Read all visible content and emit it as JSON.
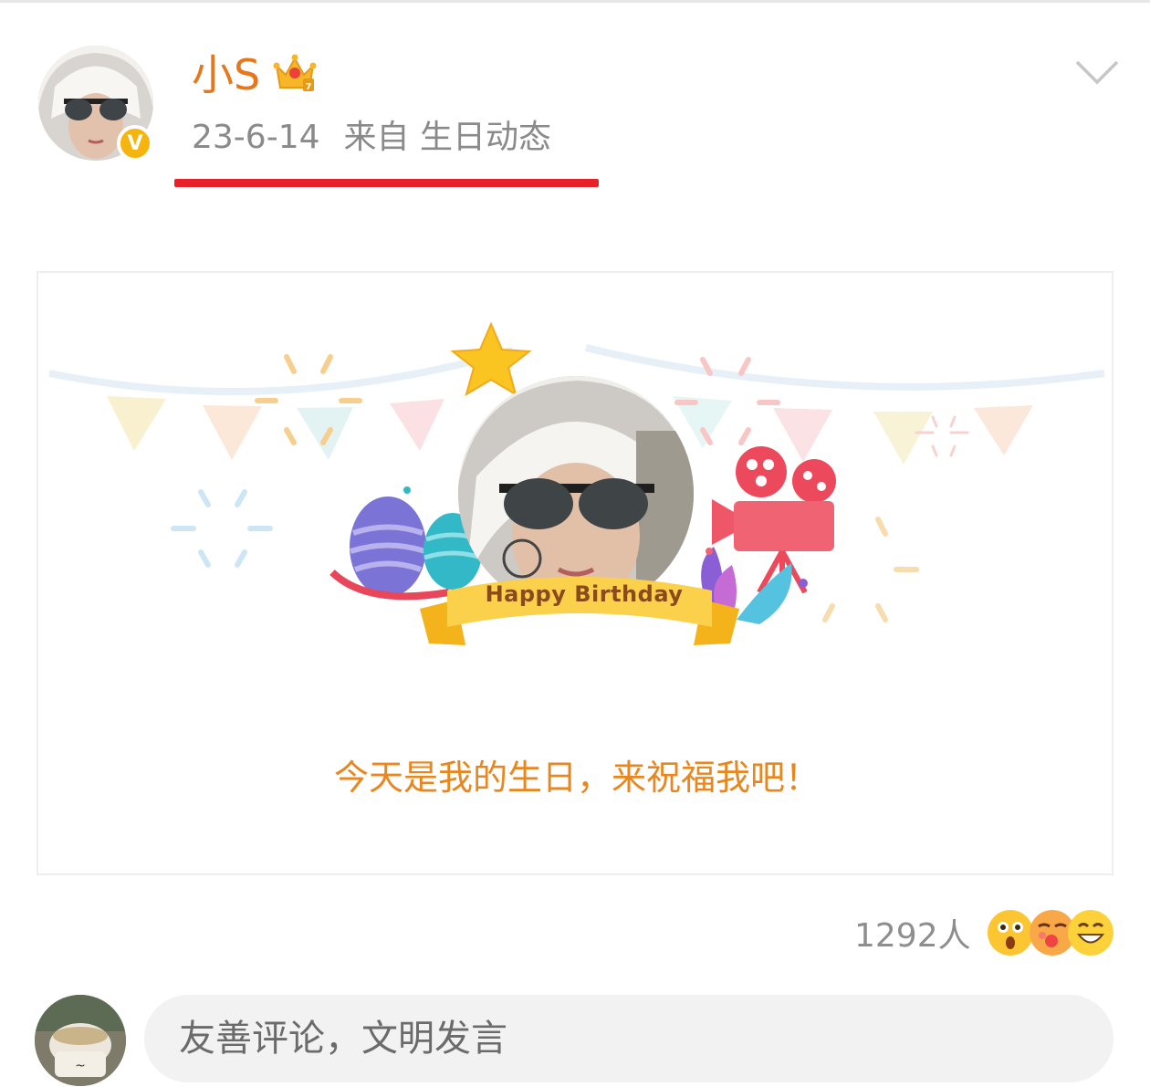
{
  "post": {
    "username": "小S",
    "date": "23-6-14",
    "source": "来自 生日动态"
  },
  "card": {
    "banner_text": "Happy Birthday",
    "blessing": "今天是我的生日，来祝福我吧！"
  },
  "reactions": {
    "count_label": "1292人",
    "emojis": [
      "surprised-emoji-icon",
      "kiss-emoji-icon",
      "grin-emoji-icon"
    ]
  },
  "comment": {
    "placeholder": "友善评论，文明发言"
  },
  "icons": {
    "verified": "verified-badge-icon",
    "member": "crown-icon",
    "menu": "chevron-down-icon"
  },
  "colors": {
    "username": "#e8761a",
    "blessing": "#e8861f",
    "highlight": "#e8202a",
    "verified": "#f6b40e"
  }
}
